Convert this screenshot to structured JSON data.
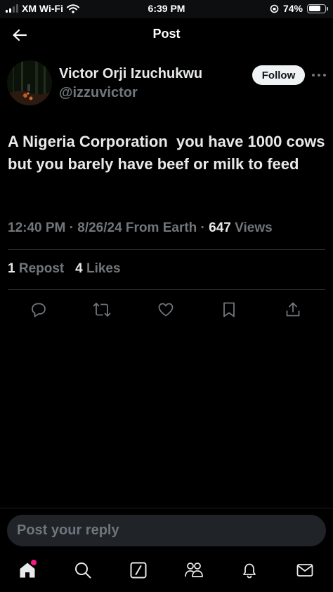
{
  "status_bar": {
    "carrier": "XM Wi-Fi",
    "time": "6:39 PM",
    "battery": "74%",
    "battery_level": 0.74
  },
  "header": {
    "title": "Post",
    "back_icon": "arrow-left-icon"
  },
  "post": {
    "author_name": "Victor Orji Izuchukwu",
    "author_handle": "@izzuvictor",
    "follow_label": "Follow",
    "text": "A Nigeria Corporation  you have 1000 cows but you barely have beef or milk to feed",
    "meta_time": "12:40 PM · 8/26/24 From Earth · ",
    "views_count": "647",
    "views_label": " Views",
    "reposts_count": "1",
    "reposts_label": " Repost",
    "likes_count": "4",
    "likes_label": " Likes"
  },
  "actions": [
    "reply-icon",
    "repost-icon",
    "like-icon",
    "bookmark-icon",
    "share-icon"
  ],
  "reply": {
    "placeholder": "Post your reply"
  },
  "tab_bar": [
    "home-icon",
    "search-icon",
    "grok-icon",
    "communities-icon",
    "notifications-icon",
    "messages-icon"
  ],
  "colors": {
    "background": "#000000",
    "text": "#e7e9ea",
    "secondary": "#71767b",
    "notification_dot": "#f91880"
  }
}
